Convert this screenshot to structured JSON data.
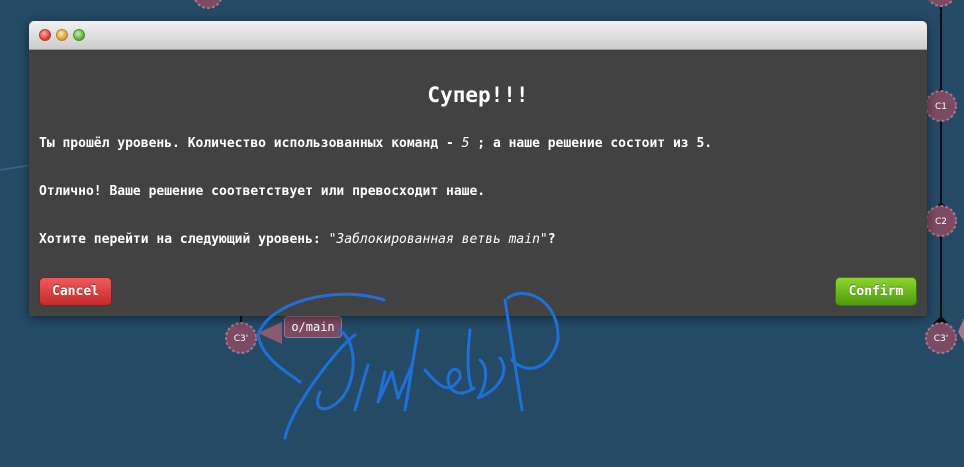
{
  "graph": {
    "nodes": [
      {
        "id": "c1",
        "label": "C1"
      },
      {
        "id": "c2",
        "label": "C2"
      },
      {
        "id": "c3-right",
        "label": "C3'"
      },
      {
        "id": "c3-left",
        "label": "C3'"
      }
    ],
    "branch_tag": "o/main",
    "colors": {
      "background": "#254a66",
      "node_fill": "#7d4a63",
      "edge": "#0b0b0b"
    }
  },
  "dialog": {
    "title": "Супер!!!",
    "line1_prefix": "Ты прошёл уровень. Количество использованных команд - ",
    "line1_count": "5",
    "line1_suffix": " ; а наше решение состоит из 5.",
    "line2": "Отлично! Ваше решение соответствует или превосходит наше.",
    "line3_prefix": "Хотите перейти на следующий уровень: ",
    "line3_level": "\"Заблокированная ветвь main\"",
    "line3_suffix": "?",
    "cancel_label": "Cancel",
    "confirm_label": "Confirm",
    "colors": {
      "cancel": "#d83a3a",
      "confirm": "#6bb81c",
      "panel": "#424242"
    }
  },
  "signature": {
    "color": "#1f6fd6"
  }
}
